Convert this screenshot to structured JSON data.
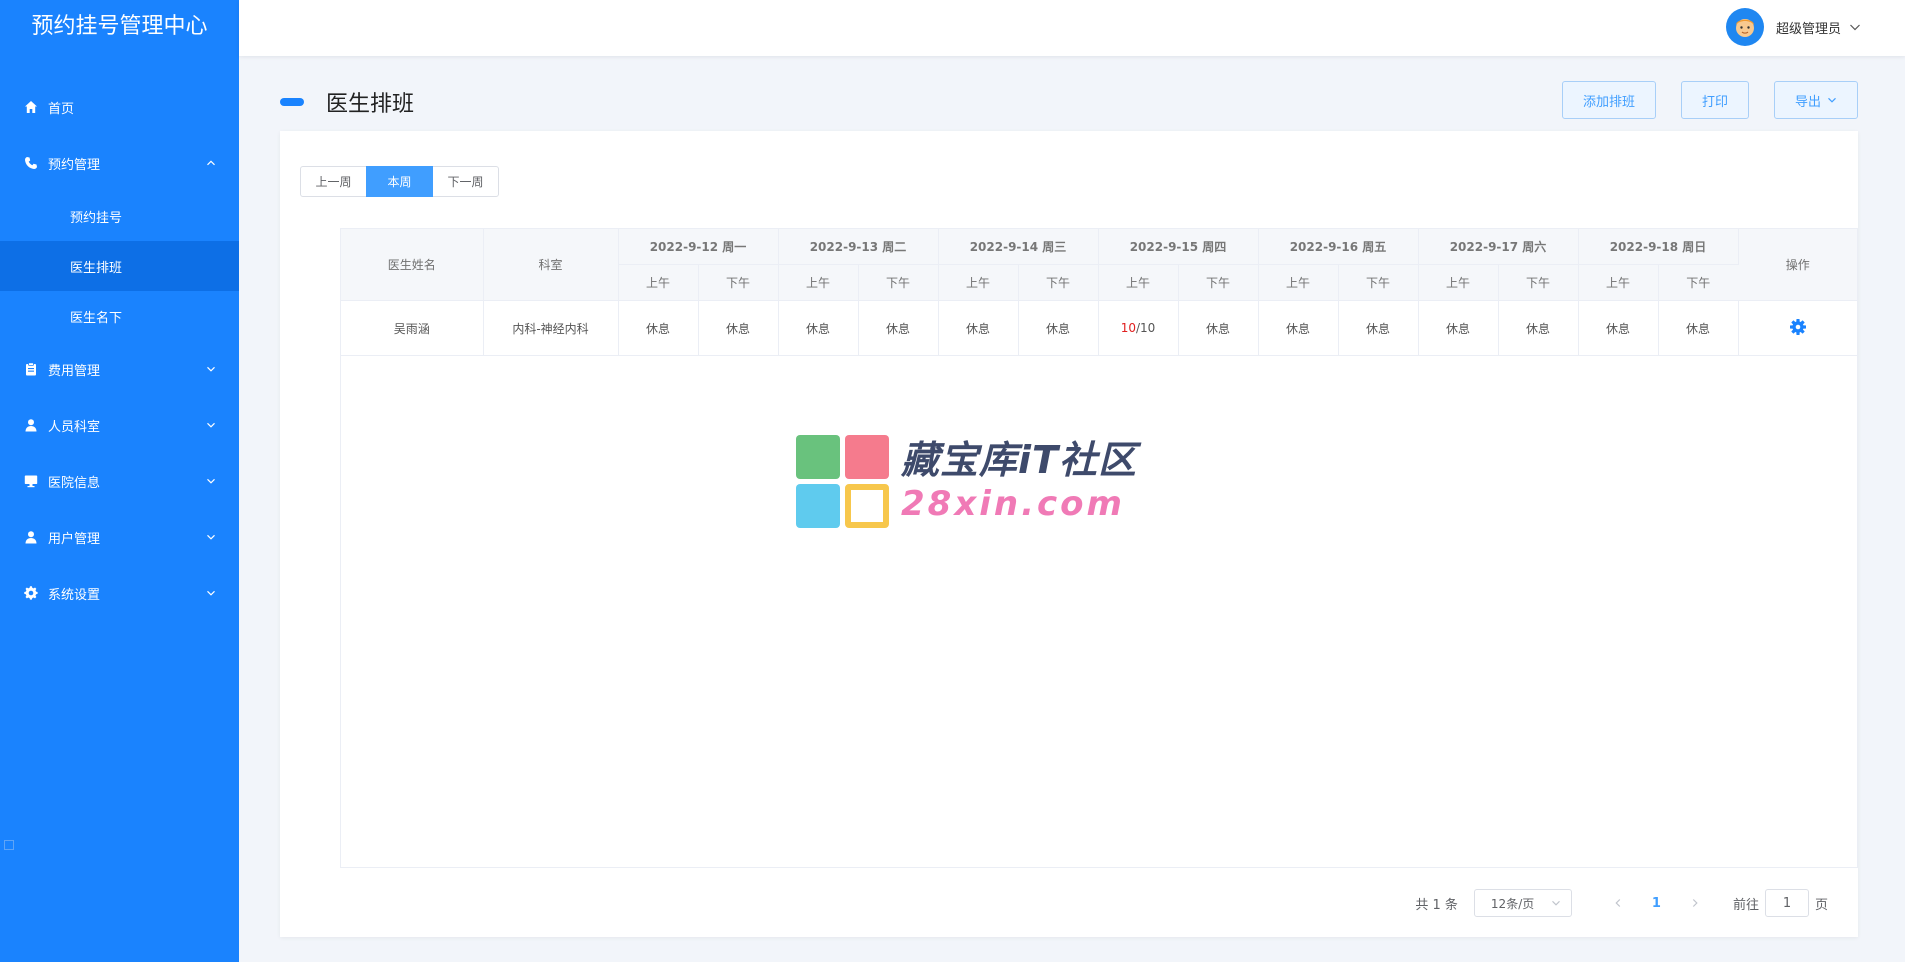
{
  "app": {
    "title": "预约挂号管理中心"
  },
  "sidebar": {
    "items": [
      {
        "label": "首页",
        "icon": "home-icon"
      },
      {
        "label": "预约管理",
        "icon": "phone-icon",
        "expanded": true,
        "children": [
          {
            "label": "预约挂号"
          },
          {
            "label": "医生排班",
            "active": true
          },
          {
            "label": "医生名下"
          }
        ]
      },
      {
        "label": "费用管理",
        "icon": "clipboard-icon"
      },
      {
        "label": "人员科室",
        "icon": "user-icon"
      },
      {
        "label": "医院信息",
        "icon": "monitor-icon"
      },
      {
        "label": "用户管理",
        "icon": "user-icon"
      },
      {
        "label": "系统设置",
        "icon": "gear-icon"
      }
    ]
  },
  "header": {
    "username": "超级管理员"
  },
  "page": {
    "title": "医生排班",
    "actions": {
      "add": "添加排班",
      "print": "打印",
      "export": "导出"
    }
  },
  "week_nav": {
    "prev": "上一周",
    "current": "本周",
    "next": "下一周"
  },
  "table": {
    "col_name": "医生姓名",
    "col_dept": "科室",
    "col_ops": "操作",
    "days": [
      "2022-9-12 周一",
      "2022-9-13 周二",
      "2022-9-14 周三",
      "2022-9-15 周四",
      "2022-9-16 周五",
      "2022-9-17 周六",
      "2022-9-18 周日"
    ],
    "am": "上午",
    "pm": "下午",
    "rows": [
      {
        "name": "吴雨涵",
        "dept": "内科-神经内科",
        "slots": [
          "休息",
          "休息",
          "休息",
          "休息",
          "休息",
          "休息",
          "10/10",
          "休息",
          "休息",
          "休息",
          "休息",
          "休息",
          "休息",
          "休息"
        ],
        "booked": "10",
        "capacity": "/10"
      }
    ]
  },
  "watermark": {
    "line1": "藏宝库iT社区",
    "line2": "28xin.com"
  },
  "pagination": {
    "total": "共 1 条",
    "page_size": "12条/页",
    "current_page": "1",
    "goto_label": "前往",
    "goto_value": "1",
    "page_suffix": "页"
  },
  "colors": {
    "sidebar": "#1a83fe",
    "primary": "#409eff",
    "alert": "#e02020"
  }
}
